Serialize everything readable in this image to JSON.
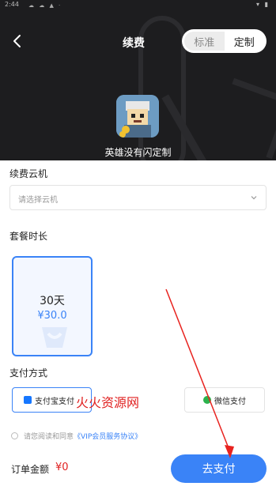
{
  "status_bar": {
    "time": "2:44",
    "indicators": "☁ ☁ ▲ ·",
    "right": "▾ ▮"
  },
  "header": {
    "title": "续费",
    "toggle": {
      "standard": "标准",
      "custom": "定制"
    },
    "game_name": "英雄没有闪定制"
  },
  "renew": {
    "label": "续费云机",
    "placeholder": "请选择云机"
  },
  "plan": {
    "label": "套餐时长",
    "card": {
      "days": "30天",
      "price": "¥30.0"
    }
  },
  "payment": {
    "label": "支付方式",
    "alipay": "支付宝支付",
    "wechat": "微信支付"
  },
  "watermark": "火火资源网",
  "agreement": {
    "text": "请您阅读和同意",
    "link": "《VIP会员服务协议》"
  },
  "order": {
    "label": "订单金额",
    "amount": "¥0"
  },
  "actions": {
    "pay": "去支付"
  },
  "colors": {
    "accent": "#3a83f7",
    "header_bg": "#1d1d1f",
    "price_red": "#e02020",
    "wechat_green": "#2cb24c"
  }
}
